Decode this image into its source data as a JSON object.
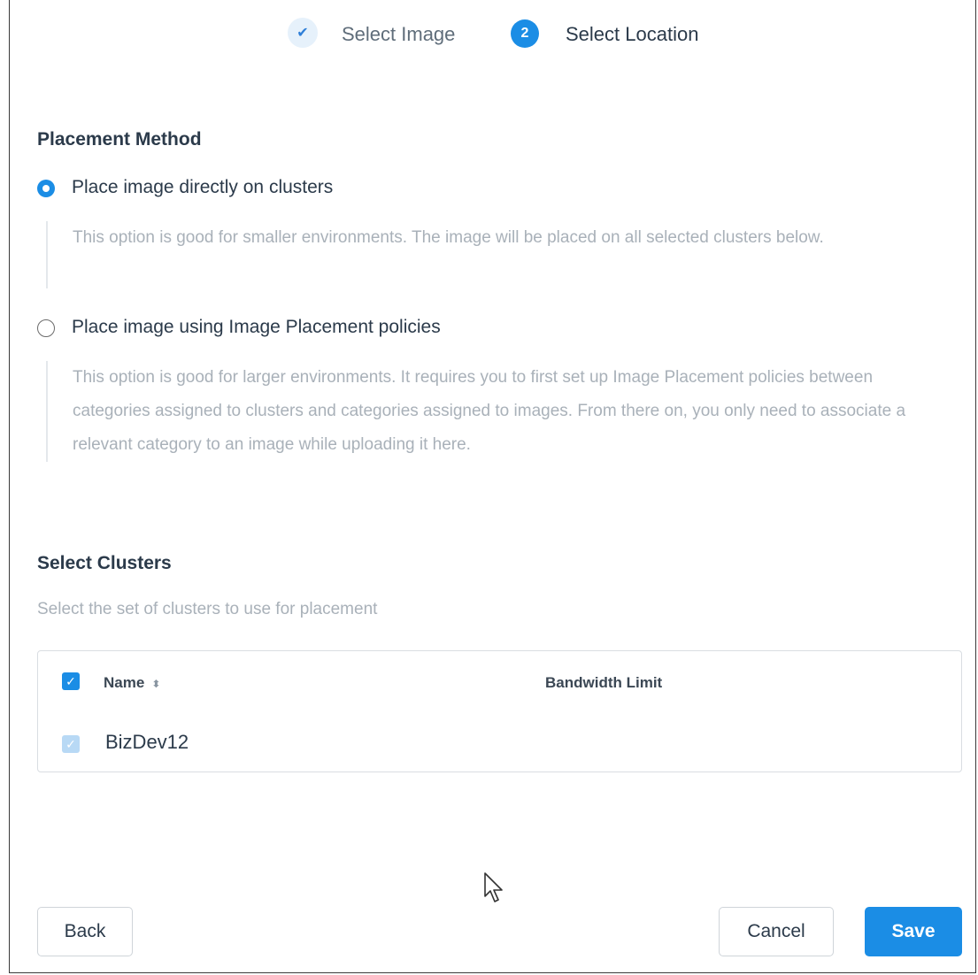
{
  "wizard": {
    "steps": [
      {
        "label": "Select Image",
        "state": "completed",
        "marker": "✔"
      },
      {
        "label": "Select Location",
        "state": "active",
        "marker": "2"
      }
    ]
  },
  "placement": {
    "title": "Placement Method",
    "options": [
      {
        "label": "Place image directly on clusters",
        "selected": true,
        "description": "This option is good for smaller environments. The image will be placed on all selected clusters below."
      },
      {
        "label": "Place image using Image Placement policies",
        "selected": false,
        "description": "This option is good for larger environments. It requires you to first set up Image Placement policies between categories assigned to clusters and categories assigned to images. From there on, you only need to associate a relevant category to an image while uploading it here."
      }
    ]
  },
  "clusters": {
    "title": "Select Clusters",
    "subtitle": "Select the set of clusters to use for placement",
    "columns": {
      "name": "Name",
      "bandwidth": "Bandwidth Limit"
    },
    "rows": [
      {
        "name": "BizDev12",
        "checked": true
      }
    ]
  },
  "footer": {
    "back_label": "Back",
    "cancel_label": "Cancel",
    "save_label": "Save"
  },
  "colors": {
    "accent": "#1b8de5",
    "muted_text": "#a9b1b9",
    "border": "#d9dde2"
  }
}
